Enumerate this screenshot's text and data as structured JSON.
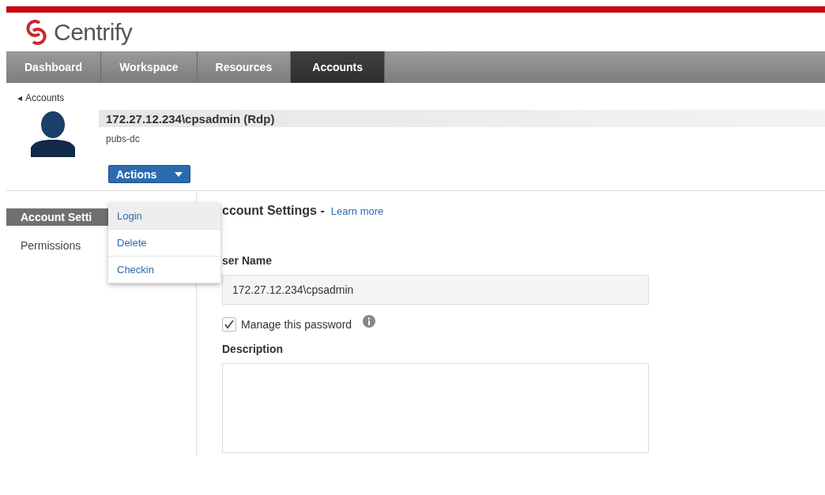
{
  "logo": {
    "name": "Centrify"
  },
  "nav_tabs": [
    {
      "label": "Dashboard",
      "selected": false
    },
    {
      "label": "Workspace",
      "selected": false
    },
    {
      "label": "Resources",
      "selected": false
    },
    {
      "label": "Accounts",
      "selected": true
    }
  ],
  "breadcrumb": {
    "icon": "◂",
    "label": "Accounts"
  },
  "account": {
    "title": "172.27.12.234\\cpsadmin (Rdp)",
    "subtitle": "pubs-dc"
  },
  "actions_button": {
    "label": "Actions",
    "expanded": true
  },
  "actions_menu": [
    {
      "label": "Login",
      "selected": true
    },
    {
      "label": "Delete",
      "selected": false
    },
    {
      "label": "Checkin",
      "selected": false
    }
  ],
  "sidebar": {
    "items": [
      {
        "label": "Account Setti",
        "selected": true
      },
      {
        "label": "Permissions",
        "selected": false
      }
    ]
  },
  "form": {
    "heading": "ccount Settings -",
    "learn_more": "Learn more",
    "user_name_label": "ser Name",
    "user_name_value": "172.27.12.234\\cpsadmin",
    "manage_password": {
      "label": "Manage this password",
      "checked": true
    },
    "description_label": "Description"
  }
}
